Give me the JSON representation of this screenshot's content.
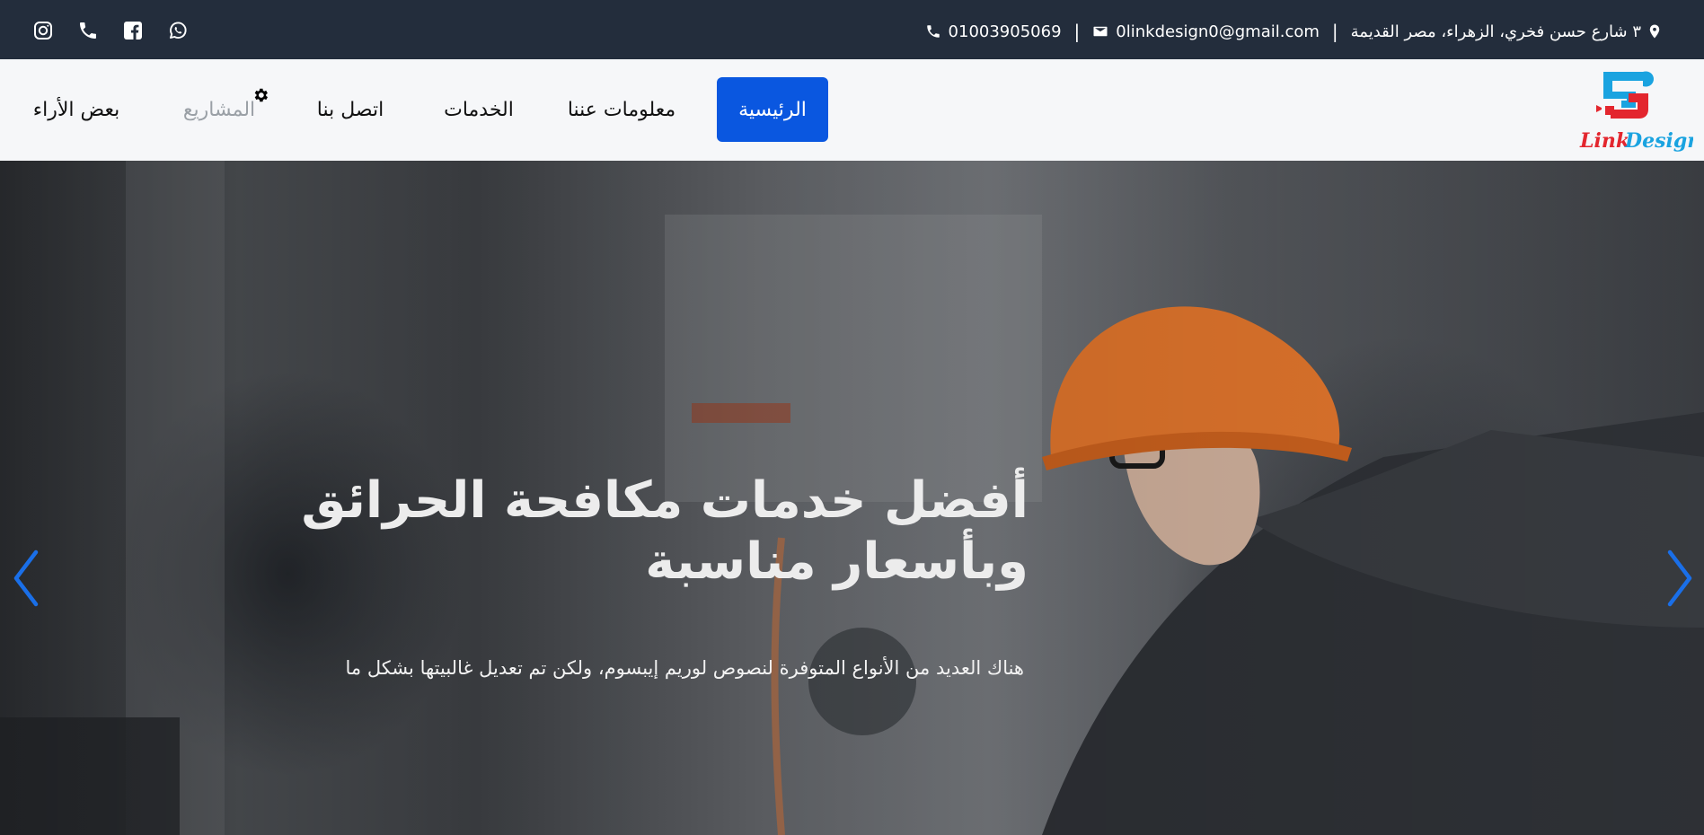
{
  "topbar": {
    "address": "٣ شارع حسن فخري، الزهراء، مصر القديمة",
    "email": "0linkdesign0@gmail.com",
    "phone": "01003905069",
    "separator": "|",
    "socials": [
      "instagram-icon",
      "phone-icon",
      "facebook-icon",
      "whatsapp-icon"
    ]
  },
  "nav": {
    "logo_text": "Link Design",
    "items": [
      {
        "label": "الرئيسية",
        "active": true
      },
      {
        "label": "معلومات عننا"
      },
      {
        "label": "الخدمات"
      },
      {
        "label": "اتصل بنا"
      },
      {
        "label": "المشاريع"
      },
      {
        "label": "بعض الأراء"
      }
    ]
  },
  "hero": {
    "title": "أفضل خدمات مكافحة الحرائق وبأسعار مناسبة",
    "subtitle": "هناك العديد من الأنواع المتوفرة لنصوص لوريم إيبسوم، ولكن تم تعديل غالبيتها بشكل ما"
  },
  "colors": {
    "topbar_bg": "#232d3c",
    "nav_bg": "#f6f7f9",
    "accent": "#0a57e0",
    "arrow": "#1a6fe8"
  }
}
